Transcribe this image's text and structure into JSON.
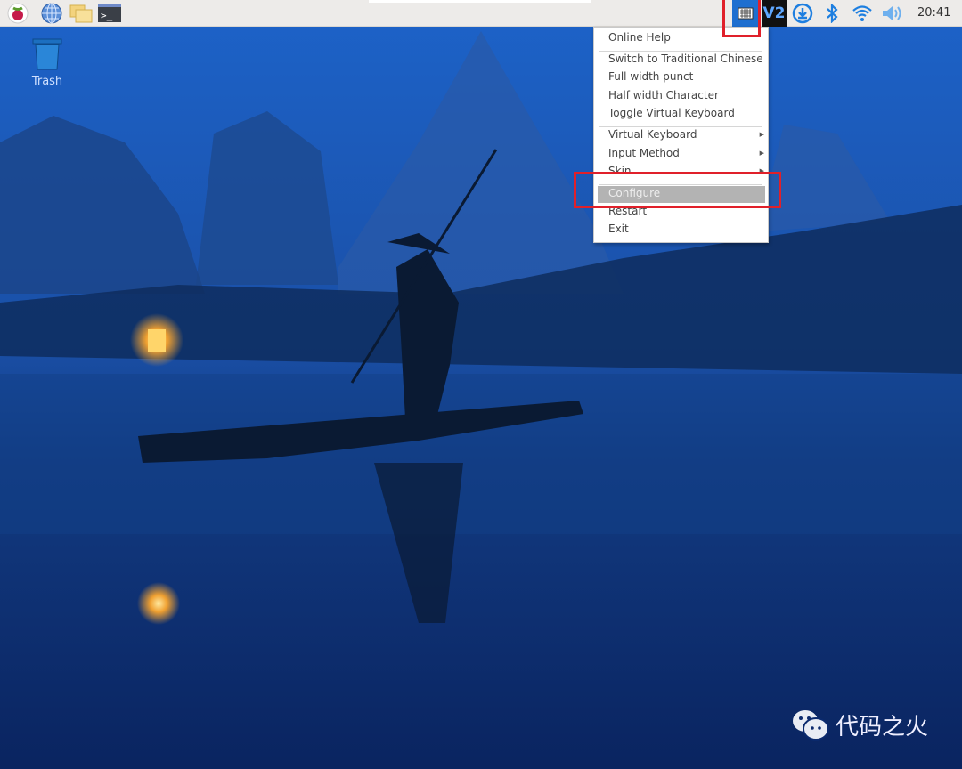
{
  "taskbar": {
    "launchers": [
      {
        "icon": "raspberry-menu-icon"
      },
      {
        "icon": "web-browser-icon"
      },
      {
        "icon": "file-manager-icon"
      },
      {
        "icon": "terminal-icon"
      }
    ],
    "tray": [
      {
        "icon": "keyboard-input-method-icon"
      },
      {
        "icon": "vnc-icon",
        "label": "V2"
      },
      {
        "icon": "download-updates-icon"
      },
      {
        "icon": "bluetooth-icon"
      },
      {
        "icon": "wifi-icon"
      },
      {
        "icon": "volume-icon"
      }
    ],
    "clock": "20:41"
  },
  "desktop": {
    "trash_label": "Trash"
  },
  "menu": {
    "items": [
      {
        "label": "Online Help"
      },
      {
        "label": "Switch to Traditional Chinese"
      },
      {
        "label": "Full width punct"
      },
      {
        "label": "Half width Character"
      },
      {
        "label": "Toggle Virtual Keyboard"
      },
      {
        "label": "Virtual Keyboard",
        "submenu": true
      },
      {
        "label": "Input Method",
        "submenu": true
      },
      {
        "label": "Skin",
        "submenu": true
      },
      {
        "label": "Configure",
        "highlighted": true
      },
      {
        "label": "Restart"
      },
      {
        "label": "Exit"
      }
    ]
  },
  "watermark": {
    "text": "代码之火",
    "icon": "wechat-icon"
  },
  "colors": {
    "taskbar": "#edebe9",
    "highlight": "#b3b3b3",
    "annotation": "#e0202a",
    "tray_active": "#1e6fd0"
  }
}
